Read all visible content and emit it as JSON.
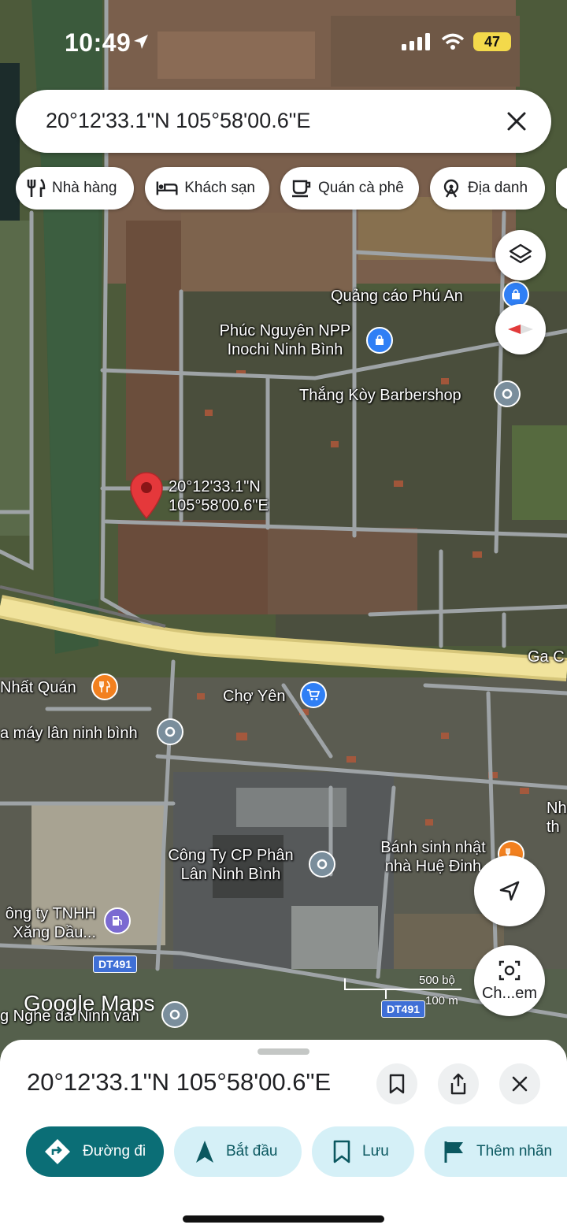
{
  "status_bar": {
    "time": "10:49",
    "battery": "47"
  },
  "search": {
    "query": "20°12'33.1\"N 105°58'00.6\"E"
  },
  "chips": [
    {
      "label": "Nhà hàng",
      "icon": "restaurant-icon"
    },
    {
      "label": "Khách sạn",
      "icon": "hotel-icon"
    },
    {
      "label": "Quán cà phê",
      "icon": "coffee-icon"
    },
    {
      "label": "Địa danh",
      "icon": "landmark-icon"
    }
  ],
  "map": {
    "pin_label_line1": "20°12'33.1\"N",
    "pin_label_line2": "105°58'00.6\"E",
    "places": {
      "quang_cao": "Quảng cáo Phú An",
      "phuc_nguyen_1": "Phúc Nguyên NPP",
      "phuc_nguyen_2": "Inochi Ninh Bình",
      "barbershop": "Thắng Kòy Barbershop",
      "ga": "Ga C",
      "nhat_quan": "Nhất Quán",
      "cho_yen": "Chợ Yên",
      "nha_may": "a máy lân ninh bình",
      "nh": "Nh",
      "th": "th",
      "cong_ty_1": "Công Ty CP Phân",
      "cong_ty_2": "Lân Ninh Bình",
      "banh_1": "Bánh sinh nhật",
      "banh_2": "nhà Huệ Đinh",
      "tnhh_1": "ông ty TNHH",
      "tnhh_2": "Xăng Dầu...",
      "nghe": "g Nghe đa Ninh van"
    },
    "road_shields": [
      "DT491",
      "DT491"
    ],
    "scale": {
      "imperial": "500 bộ",
      "metric": "100 m"
    },
    "watermark": "Google Maps",
    "camera_button_label": "Ch...em"
  },
  "sheet": {
    "title": "20°12'33.1\"N 105°58'00.6\"E",
    "actions": [
      {
        "label": "Đường đi",
        "icon": "directions-icon"
      },
      {
        "label": "Bắt đầu",
        "icon": "navigation-arrow-icon"
      },
      {
        "label": "Lưu",
        "icon": "bookmark-icon"
      },
      {
        "label": "Thêm nhãn",
        "icon": "flag-icon"
      }
    ]
  },
  "colors": {
    "primary": "#0b6e76",
    "secondary": "#d5f0f7",
    "pin": "#e5383b",
    "highway": "#f1e39c"
  }
}
